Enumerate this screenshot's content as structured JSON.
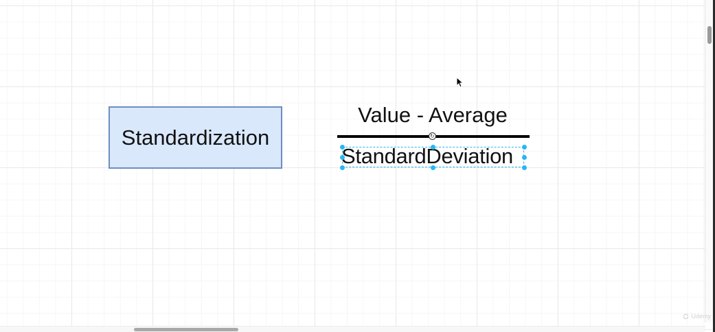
{
  "diagram": {
    "box_label": "Standardization",
    "numerator": "Value - Average",
    "denominator": "StandardDeviation",
    "box_fill": "#dae8fc",
    "box_stroke": "#6c8ebf",
    "selection_color": "#29b6f2"
  },
  "icons": {
    "cursor": "mouse-pointer-icon",
    "rotate": "rotate-icon",
    "watermark": "udemy-logo-icon"
  },
  "watermark_text": "Udemy"
}
